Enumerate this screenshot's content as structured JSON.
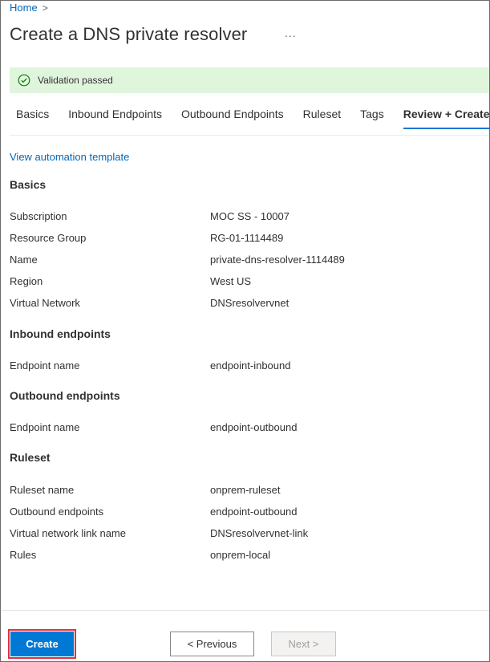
{
  "breadcrumb": {
    "home": "Home",
    "chevron": ">"
  },
  "header": {
    "title": "Create a DNS private resolver",
    "more": "..."
  },
  "banner": {
    "text": "Validation passed",
    "icon": "check-circle-icon",
    "color": "#dff6dd",
    "icon_color": "#107c10"
  },
  "tabs": [
    {
      "label": "Basics"
    },
    {
      "label": "Inbound Endpoints"
    },
    {
      "label": "Outbound Endpoints"
    },
    {
      "label": "Ruleset"
    },
    {
      "label": "Tags"
    },
    {
      "label": "Review + Create",
      "active": true
    }
  ],
  "automation_link": "View automation template",
  "sections": {
    "basics": {
      "heading": "Basics",
      "rows": [
        {
          "label": "Subscription",
          "value": "MOC SS - 10007"
        },
        {
          "label": "Resource Group",
          "value": "RG-01-1114489"
        },
        {
          "label": "Name",
          "value": "private-dns-resolver-1114489"
        },
        {
          "label": "Region",
          "value": "West US"
        },
        {
          "label": "Virtual Network",
          "value": "DNSresolvervnet"
        }
      ]
    },
    "inbound": {
      "heading": "Inbound endpoints",
      "rows": [
        {
          "label": "Endpoint name",
          "value": "endpoint-inbound"
        }
      ]
    },
    "outbound": {
      "heading": "Outbound endpoints",
      "rows": [
        {
          "label": "Endpoint name",
          "value": "endpoint-outbound"
        }
      ]
    },
    "ruleset": {
      "heading": "Ruleset",
      "rows": [
        {
          "label": "Ruleset name",
          "value": "onprem-ruleset"
        },
        {
          "label": "Outbound endpoints",
          "value": "endpoint-outbound"
        },
        {
          "label": "Virtual network link name",
          "value": "DNSresolvervnet-link"
        },
        {
          "label": "Rules",
          "value": "onprem-local"
        }
      ]
    }
  },
  "footer": {
    "create": "Create",
    "previous": "< Previous",
    "next": "Next >",
    "accent": "#0078d4",
    "highlight": "#e0323b"
  }
}
